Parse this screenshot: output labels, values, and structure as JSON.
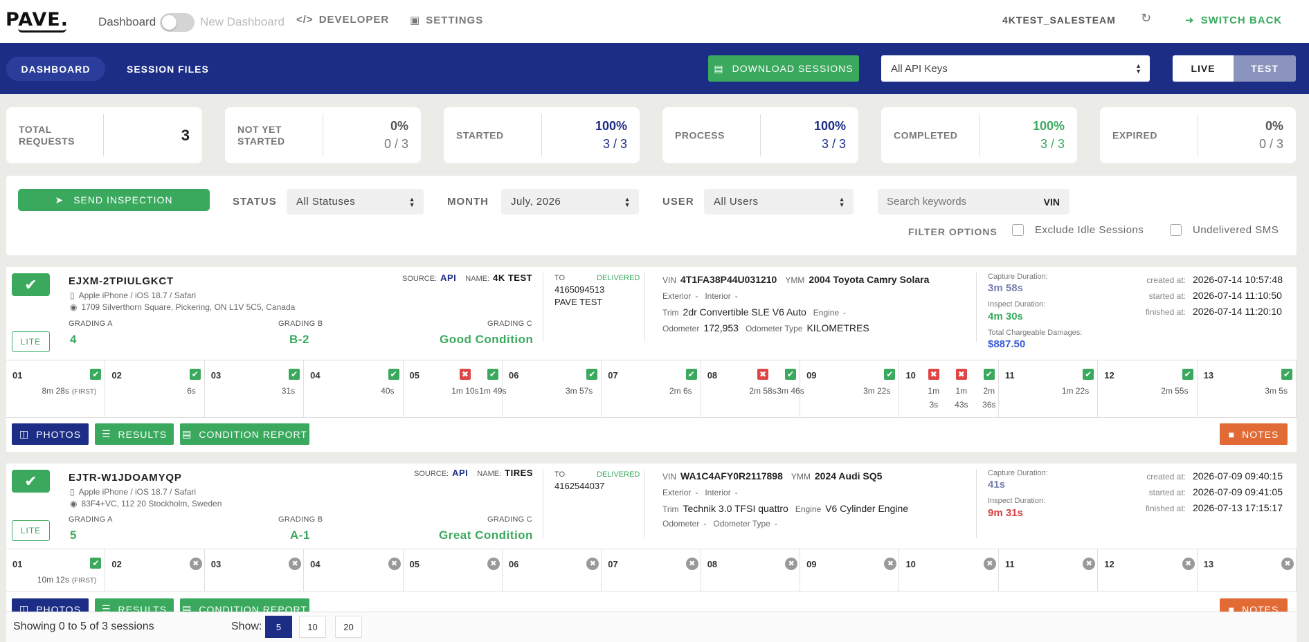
{
  "topbar": {
    "logo": "PAVE.",
    "dashboard": "Dashboard",
    "new_dashboard": "New Dashboard",
    "developer": "DEVELOPER",
    "settings": "SETTINGS",
    "account": "4KTEST_SALESTEAM",
    "switch_back": "SWITCH BACK",
    "refresh_icon": "refresh-icon"
  },
  "nav": {
    "dashboard": "DASHBOARD",
    "session_files": "SESSION FILES",
    "download": "DOWNLOAD SESSIONS",
    "api_keys": "All API Keys",
    "live": "LIVE",
    "test": "TEST"
  },
  "stats": [
    {
      "label": "TOTAL REQUESTS",
      "value": "3"
    },
    {
      "label": "NOT YET STARTED",
      "pct": "0%",
      "frac": "0 / 3"
    },
    {
      "label": "STARTED",
      "pct": "100%",
      "frac": "3 / 3"
    },
    {
      "label": "PROCESS",
      "pct": "100%",
      "frac": "3 / 3"
    },
    {
      "label": "COMPLETED",
      "pct": "100%",
      "frac": "3 / 3"
    },
    {
      "label": "EXPIRED",
      "pct": "0%",
      "frac": "0 / 3"
    }
  ],
  "filters": {
    "send": "SEND INSPECTION",
    "status_label": "STATUS",
    "status": "All Statuses",
    "month_label": "MONTH",
    "month": "July, 2026",
    "user_label": "USER",
    "user": "All Users",
    "search_placeholder": "Search keywords",
    "vin": "VIN",
    "filter_options": "FILTER OPTIONS",
    "exclude_idle": "Exclude Idle Sessions",
    "undelivered": "Undelivered SMS"
  },
  "sessions": [
    {
      "id": "EJXM-2TPIULGKCT",
      "device": "Apple iPhone / iOS 18.7 / Safari",
      "address": "1709 Silverthorn Square, Pickering, ON L1V 5C5, Canada",
      "source_label": "SOURCE:",
      "source": "API",
      "name_label": "NAME:",
      "name": "4K TEST",
      "lite": "LITE",
      "grading_a_label": "GRADING A",
      "grading_a": "4",
      "grading_b_label": "GRADING B",
      "grading_b": "B-2",
      "grading_c_label": "GRADING C",
      "grading_c": "Good Condition",
      "to_label": "TO",
      "delivered": "DELIVERED",
      "phone": "4165094513",
      "recipient": "PAVE TEST",
      "vin_label": "VIN",
      "vin": "4T1FA38P44U031210",
      "ymm_label": "YMM",
      "ymm": "2004 Toyota Camry Solara",
      "exterior_label": "Exterior",
      "exterior": "-",
      "interior_label": "Interior",
      "interior": "-",
      "trim_label": "Trim",
      "trim": "2dr Convertible SLE V6 Auto",
      "engine_label": "Engine",
      "engine": "-",
      "odometer_label": "Odometer",
      "odometer": "172,953",
      "odometer_type_label": "Odometer Type",
      "odometer_type": "KILOMETRES",
      "capture_label": "Capture Duration:",
      "capture": "3m 58s",
      "inspect_label": "Inspect Duration:",
      "inspect": "4m 30s",
      "damages_label": "Total Chargeable Damages:",
      "damages": "$887.50",
      "created_label": "created at:",
      "created": "2026-07-14 10:57:48",
      "started_label": "started at:",
      "started": "2026-07-14 11:10:50",
      "finished_label": "finished at:",
      "finished": "2026-07-14 11:20:10",
      "steps": [
        {
          "n": "01",
          "marks": [
            "ok"
          ],
          "durs": [
            "8m 28s"
          ],
          "first": "(FIRST)"
        },
        {
          "n": "02",
          "marks": [
            "ok"
          ],
          "durs": [
            "6s"
          ]
        },
        {
          "n": "03",
          "marks": [
            "ok"
          ],
          "durs": [
            "31s"
          ]
        },
        {
          "n": "04",
          "marks": [
            "ok"
          ],
          "durs": [
            "40s"
          ]
        },
        {
          "n": "05",
          "marks": [
            "bad",
            "ok"
          ],
          "durs": [
            "1m 10s",
            "1m 49s"
          ]
        },
        {
          "n": "06",
          "marks": [
            "ok"
          ],
          "durs": [
            "3m 57s"
          ]
        },
        {
          "n": "07",
          "marks": [
            "ok"
          ],
          "durs": [
            "2m 6s"
          ]
        },
        {
          "n": "08",
          "marks": [
            "bad",
            "ok"
          ],
          "durs": [
            "2m 58s",
            "3m 46s"
          ]
        },
        {
          "n": "09",
          "marks": [
            "ok"
          ],
          "durs": [
            "3m 22s"
          ]
        },
        {
          "n": "10",
          "marks": [
            "bad",
            "bad",
            "ok"
          ],
          "durs": [
            "1m 3s",
            "1m 43s",
            "2m 36s"
          ]
        },
        {
          "n": "11",
          "marks": [
            "ok"
          ],
          "durs": [
            "1m 22s"
          ]
        },
        {
          "n": "12",
          "marks": [
            "ok"
          ],
          "durs": [
            "2m 55s"
          ]
        },
        {
          "n": "13",
          "marks": [
            "ok"
          ],
          "durs": [
            "3m 5s"
          ]
        }
      ],
      "photos": "PHOTOS",
      "results": "RESULTS",
      "report": "CONDITION REPORT",
      "notes": "NOTES"
    },
    {
      "id": "EJTR-W1JDOAMYQP",
      "device": "Apple iPhone / iOS 18.7 / Safari",
      "address": "83F4+VC, 112 20 Stockholm, Sweden",
      "source_label": "SOURCE:",
      "source": "API",
      "name_label": "NAME:",
      "name": "TIRES",
      "lite": "LITE",
      "grading_a_label": "GRADING A",
      "grading_a": "5",
      "grading_b_label": "GRADING B",
      "grading_b": "A-1",
      "grading_c_label": "GRADING C",
      "grading_c": "Great Condition",
      "to_label": "TO",
      "delivered": "DELIVERED",
      "phone": "4162544037",
      "recipient": "",
      "vin_label": "VIN",
      "vin": "WA1C4AFY0R2117898",
      "ymm_label": "YMM",
      "ymm": "2024 Audi SQ5",
      "exterior_label": "Exterior",
      "exterior": "-",
      "interior_label": "Interior",
      "interior": "-",
      "trim_label": "Trim",
      "trim": "Technik 3.0 TFSI quattro",
      "engine_label": "Engine",
      "engine": "V6 Cylinder Engine",
      "odometer_label": "Odometer",
      "odometer": "-",
      "odometer_type_label": "Odometer Type",
      "odometer_type": "-",
      "capture_label": "Capture Duration:",
      "capture": "41s",
      "inspect_label": "Inspect Duration:",
      "inspect": "9m 31s",
      "created_label": "created at:",
      "created": "2026-07-09 09:40:15",
      "started_label": "started at:",
      "started": "2026-07-09 09:41:05",
      "finished_label": "finished at:",
      "finished": "2026-07-13 17:15:17",
      "steps": [
        {
          "n": "01",
          "marks": [
            "ok"
          ],
          "durs": [
            "10m 12s"
          ],
          "first": "(FIRST)"
        },
        {
          "n": "02",
          "marks": [
            "na"
          ],
          "durs": []
        },
        {
          "n": "03",
          "marks": [
            "na"
          ],
          "durs": []
        },
        {
          "n": "04",
          "marks": [
            "na"
          ],
          "durs": []
        },
        {
          "n": "05",
          "marks": [
            "na"
          ],
          "durs": []
        },
        {
          "n": "06",
          "marks": [
            "na"
          ],
          "durs": []
        },
        {
          "n": "07",
          "marks": [
            "na"
          ],
          "durs": []
        },
        {
          "n": "08",
          "marks": [
            "na"
          ],
          "durs": []
        },
        {
          "n": "09",
          "marks": [
            "na"
          ],
          "durs": []
        },
        {
          "n": "10",
          "marks": [
            "na"
          ],
          "durs": []
        },
        {
          "n": "11",
          "marks": [
            "na"
          ],
          "durs": []
        },
        {
          "n": "12",
          "marks": [
            "na"
          ],
          "durs": []
        },
        {
          "n": "13",
          "marks": [
            "na"
          ],
          "durs": []
        }
      ],
      "photos": "PHOTOS",
      "results": "RESULTS",
      "report": "CONDITION REPORT",
      "notes": "NOTES"
    }
  ],
  "footer": {
    "showing": "Showing 0 to 5 of 3 sessions",
    "show_label": "Show:",
    "sizes": [
      "5",
      "10",
      "20"
    ]
  },
  "colors": {
    "navy": "#1c2d86",
    "green": "#3aa95e",
    "orange": "#e16a35",
    "red": "#e04545",
    "inspect_red": "#d84040",
    "capture_purple": "#7a7fb0",
    "damages_blue": "#3c5bd8"
  }
}
